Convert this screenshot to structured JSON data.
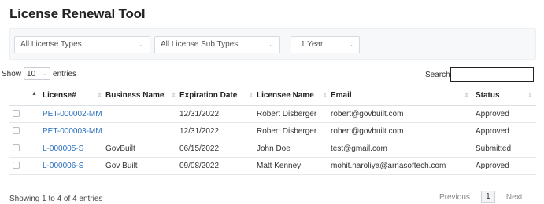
{
  "page_title": "License Renewal Tool",
  "filters": {
    "license_type": "All License Types",
    "license_sub_type": "All License Sub Types",
    "period": "1 Year"
  },
  "length": {
    "prefix": "Show",
    "value": "10",
    "suffix": "entries"
  },
  "search": {
    "label": "Search:",
    "value": ""
  },
  "table": {
    "headers": {
      "license": "License#",
      "business": "Business Name",
      "expiration": "Expiration Date",
      "licensee": "Licensee Name",
      "email": "Email",
      "status": "Status"
    },
    "rows": [
      {
        "license": "PET-000002-MM",
        "business": "",
        "expiration": "12/31/2022",
        "licensee": "Robert Disberger",
        "email": "robert@govbuilt.com",
        "status": "Approved"
      },
      {
        "license": "PET-000003-MM",
        "business": "",
        "expiration": "12/31/2022",
        "licensee": "Robert Disberger",
        "email": "robert@govbuilt.com",
        "status": "Approved"
      },
      {
        "license": "L-000005-S",
        "business": "GovBuilt",
        "expiration": "06/15/2022",
        "licensee": "John Doe",
        "email": "test@gmail.com",
        "status": "Submitted"
      },
      {
        "license": "L-000006-S",
        "business": "Gov Built",
        "expiration": "09/08/2022",
        "licensee": "Matt Kenney",
        "email": "mohit.naroliya@arnasoftech.com",
        "status": "Approved"
      }
    ]
  },
  "footer": {
    "info": "Showing 1 to 4 of 4 entries",
    "previous": "Previous",
    "page": "1",
    "next": "Next"
  }
}
